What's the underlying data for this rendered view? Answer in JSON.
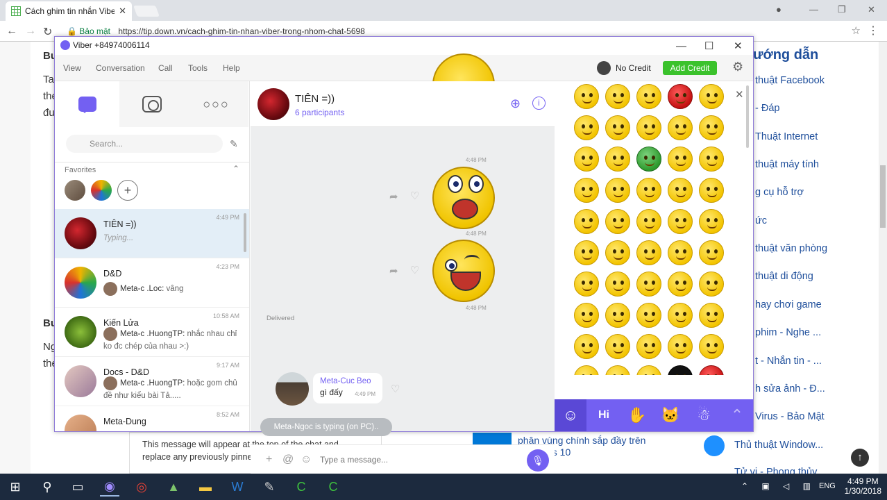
{
  "browser": {
    "tab_title": "Cách ghim tin nhắn Vibe",
    "secure_label": "Bảo mật",
    "url": "https://tip.down.vn/cach-ghim-tin-nhan-viber-trong-nhom-chat-5698",
    "minimize": "—",
    "restore": "❐",
    "close": "✕"
  },
  "page": {
    "left_snippets": [
      "Bư",
      "Ta",
      "the",
      "đu",
      "Bư",
      "Ng",
      "the"
    ],
    "side_heading": "ướng dẫn",
    "side_items": [
      "thuật Facebook",
      "- Đáp",
      "Thuật Internet",
      "thuật máy tính",
      "g cụ hỗ trợ",
      "ức",
      "thuật văn phòng",
      "thuật di động",
      "hay chơi game",
      "phim - Nghe ...",
      "t - Nhắn tin - ...",
      "h sửa ảnh - Đ...",
      "Virus - Bảo Mật",
      "Thủ thuật Window...",
      "Tử vi - Phong thủy"
    ],
    "pin_notice_line1": "This message will appear at the top of the chat and",
    "pin_notice_line2": "replace any previously pinned message.",
    "article_text": "phân vùng chính sắp đầy trên Windows 10"
  },
  "viber": {
    "title": "Viber +84974006114",
    "menu": [
      "View",
      "Conversation",
      "Call",
      "Tools",
      "Help"
    ],
    "no_credit": "No Credit",
    "add_credit": "Add Credit",
    "search_placeholder": "Search...",
    "favorites_label": "Favorites",
    "chats": [
      {
        "name": "TIÊN =))",
        "time": "4:49 PM",
        "msg": "Typing..."
      },
      {
        "name": "D&D",
        "time": "4:23 PM",
        "sender": "Meta-c .Loc:",
        "msg": "vâng"
      },
      {
        "name": "Kiến Lửa",
        "time": "10:58 AM",
        "sender": "Meta-c .HuongTP:",
        "msg": "nhắc nhau chỉ ko đc chép của nhau >:)"
      },
      {
        "name": "Docs - D&D",
        "time": "9:17 AM",
        "sender": "Meta-c .HuongTP:",
        "msg": "hoặc gom chủ đề như kiểu bài Tả....."
      },
      {
        "name": "Meta-Dung",
        "time": "8:52 AM",
        "msg": ""
      }
    ],
    "conversation": {
      "name": "TIÊN =))",
      "participants": "6 participants",
      "sticker_times": [
        "4:48 PM",
        "4:48 PM",
        "4:48 PM"
      ],
      "delivered": "Delivered",
      "bubble_sender": "Meta-Cuc Beo",
      "bubble_text": "gì đấy",
      "bubble_time": "4:49 PM",
      "typing": "Meta-Ngoc is typing (on PC)..",
      "input_placeholder": "Type a message..."
    },
    "emoji_tabs": [
      "☺",
      "Hi",
      "✋",
      "🐱",
      "☃",
      "⌃"
    ]
  },
  "taskbar": {
    "lang": "ENG",
    "time": "4:49 PM",
    "date": "1/30/2018"
  }
}
